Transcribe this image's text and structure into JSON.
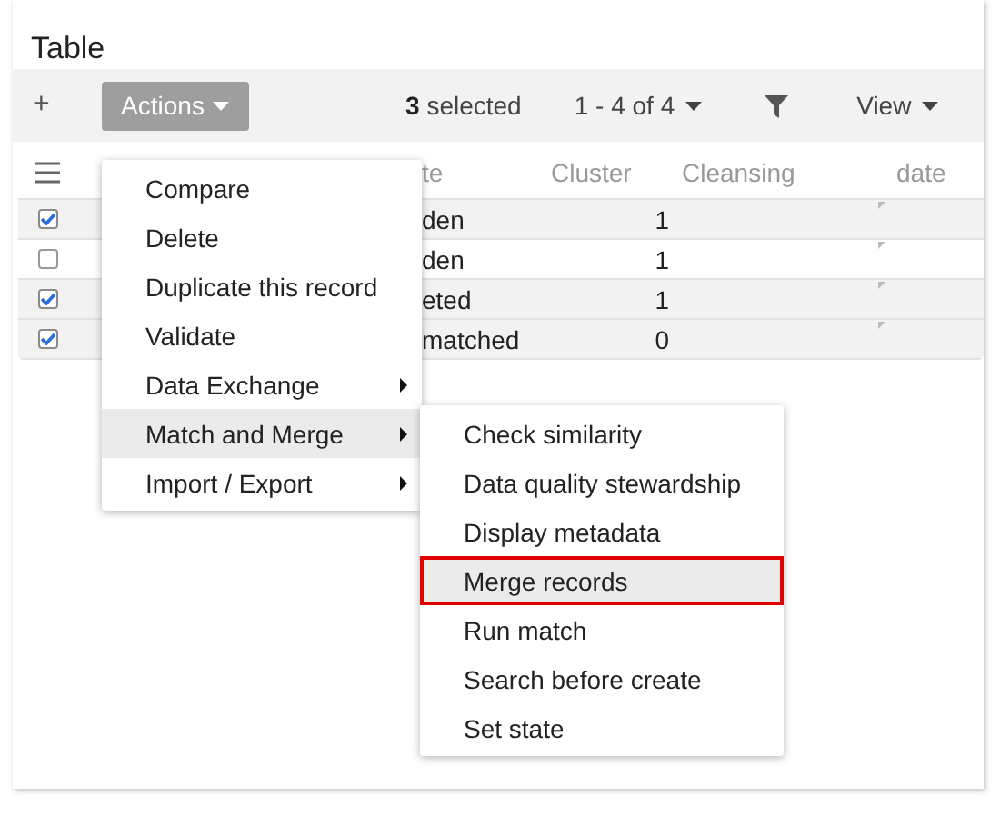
{
  "title": "Table",
  "toolbar": {
    "add": "+",
    "actions": "Actions",
    "selected_count": "3",
    "selected_label": "selected",
    "pagination": "1 - 4 of 4",
    "view": "View"
  },
  "table": {
    "columns": [
      "te",
      "Cluster",
      "Cleansing",
      "date"
    ],
    "rows": [
      {
        "checked": true,
        "cells": [
          "den",
          "1"
        ]
      },
      {
        "checked": false,
        "cells": [
          "den",
          "1"
        ]
      },
      {
        "checked": true,
        "cells": [
          "eted",
          "1"
        ]
      },
      {
        "checked": true,
        "cells": [
          "matched",
          "0"
        ]
      }
    ]
  },
  "menu": {
    "items": [
      {
        "label": "Compare",
        "has_submenu": false,
        "selected": false
      },
      {
        "label": "Delete",
        "has_submenu": false,
        "selected": false
      },
      {
        "label": "Duplicate this record",
        "has_submenu": false,
        "selected": false
      },
      {
        "label": "Validate",
        "has_submenu": false,
        "selected": false
      },
      {
        "label": "Data Exchange",
        "has_submenu": true,
        "selected": false
      },
      {
        "label": "Match and Merge",
        "has_submenu": true,
        "selected": true
      },
      {
        "label": "Import / Export",
        "has_submenu": true,
        "selected": false
      }
    ]
  },
  "submenu": {
    "items": [
      {
        "label": "Check similarity",
        "selected": false
      },
      {
        "label": "Data quality stewardship",
        "selected": false
      },
      {
        "label": "Display metadata",
        "selected": false
      },
      {
        "label": "Merge records",
        "selected": true
      },
      {
        "label": "Run match",
        "selected": false
      },
      {
        "label": "Search before create",
        "selected": false
      },
      {
        "label": "Set state",
        "selected": false
      }
    ]
  }
}
